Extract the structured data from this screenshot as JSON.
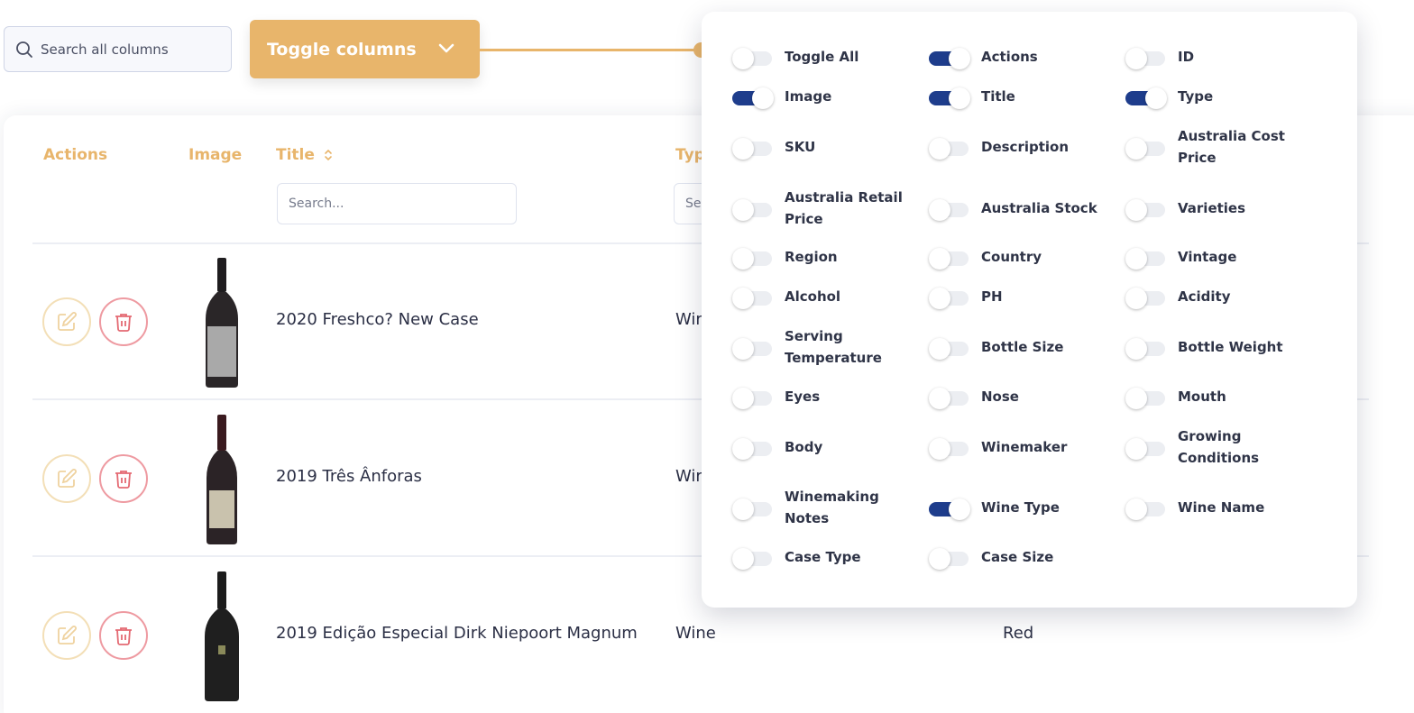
{
  "search": {
    "placeholder": "Search all columns"
  },
  "toggle_columns": {
    "label": "Toggle columns"
  },
  "table": {
    "headers": {
      "actions": "Actions",
      "image": "Image",
      "title": "Title",
      "type": "Typ"
    },
    "title_search_placeholder": "Search...",
    "type_search_placeholder": "Se",
    "rows": [
      {
        "title": "2020 Freshco? New Case",
        "type": "Wir",
        "wine_type": ""
      },
      {
        "title": "2019 Três Ânforas",
        "type": "Wir",
        "wine_type": ""
      },
      {
        "title": "2019 Edição Especial Dirk Niepoort Magnum",
        "type": "Wine",
        "wine_type": "Red"
      }
    ]
  },
  "columns_panel": {
    "options": [
      {
        "label": "Toggle All",
        "on": false
      },
      {
        "label": "Actions",
        "on": true
      },
      {
        "label": "ID",
        "on": false
      },
      {
        "label": "Image",
        "on": true
      },
      {
        "label": "Title",
        "on": true
      },
      {
        "label": "Type",
        "on": true
      },
      {
        "label": "SKU",
        "on": false
      },
      {
        "label": "Description",
        "on": false
      },
      {
        "label": "Australia Cost Price",
        "on": false
      },
      {
        "label": "Australia Retail Price",
        "on": false
      },
      {
        "label": "Australia Stock",
        "on": false
      },
      {
        "label": "Varieties",
        "on": false
      },
      {
        "label": "Region",
        "on": false
      },
      {
        "label": "Country",
        "on": false
      },
      {
        "label": "Vintage",
        "on": false
      },
      {
        "label": "Alcohol",
        "on": false
      },
      {
        "label": "PH",
        "on": false
      },
      {
        "label": "Acidity",
        "on": false
      },
      {
        "label": "Serving Temperature",
        "on": false
      },
      {
        "label": "Bottle Size",
        "on": false
      },
      {
        "label": "Bottle Weight",
        "on": false
      },
      {
        "label": "Eyes",
        "on": false
      },
      {
        "label": "Nose",
        "on": false
      },
      {
        "label": "Mouth",
        "on": false
      },
      {
        "label": "Body",
        "on": false
      },
      {
        "label": "Winemaker",
        "on": false
      },
      {
        "label": "Growing Conditions",
        "on": false
      },
      {
        "label": "Winemaking Notes",
        "on": false
      },
      {
        "label": "Wine Type",
        "on": true
      },
      {
        "label": "Wine Name",
        "on": false
      },
      {
        "label": "Case Type",
        "on": false
      },
      {
        "label": "Case Size",
        "on": false
      }
    ]
  },
  "colors": {
    "accent": "#e8b56b",
    "switch_on": "#1e3d8c",
    "delete": "#e46a73"
  }
}
